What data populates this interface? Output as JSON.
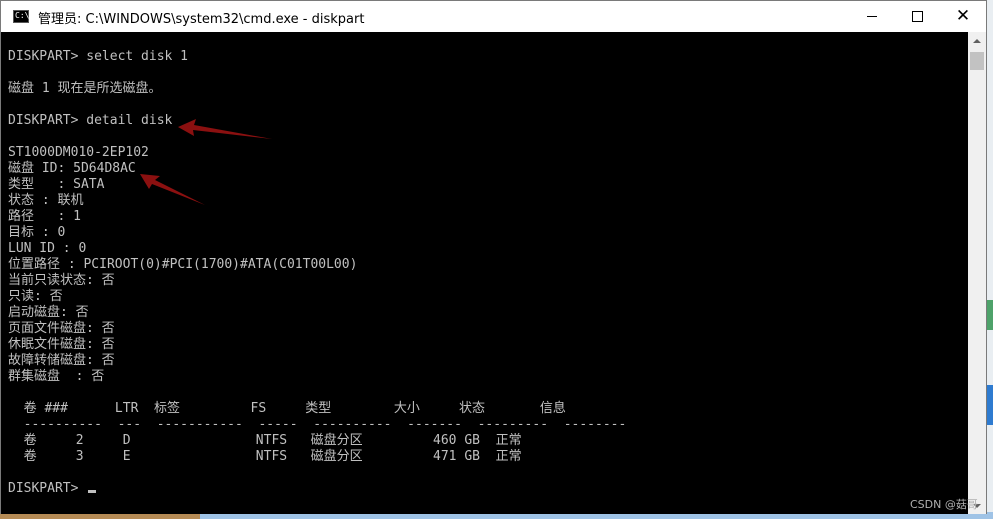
{
  "window": {
    "title": "管理员: C:\\WINDOWS\\system32\\cmd.exe - diskpart",
    "icon_label": "C:\\",
    "icons": {
      "app": "cmd-icon",
      "minimize": "minimize-icon",
      "maximize": "maximize-icon",
      "close": "close-icon"
    }
  },
  "console": {
    "lines": [
      "DISKPART> select disk 1",
      "",
      "磁盘 1 现在是所选磁盘。",
      "",
      "DISKPART> detail disk",
      "",
      "ST1000DM010-2EP102",
      "磁盘 ID: 5D64D8AC",
      "类型   : SATA",
      "状态 : 联机",
      "路径   : 1",
      "目标 : 0",
      "LUN ID : 0",
      "位置路径 : PCIROOT(0)#PCI(1700)#ATA(C01T00L00)",
      "当前只读状态: 否",
      "只读: 否",
      "启动磁盘: 否",
      "页面文件磁盘: 否",
      "休眠文件磁盘: 否",
      "故障转储磁盘: 否",
      "群集磁盘  : 否",
      "",
      "  卷 ###      LTR  标签         FS     类型        大小     状态       信息",
      "  ----------  ---  -----------  -----  ----------  -------  ---------  --------",
      "  卷     2     D                NTFS   磁盘分区         460 GB  正常",
      "  卷     3     E                NTFS   磁盘分区         471 GB  正常",
      "",
      "DISKPART> "
    ]
  },
  "colors": {
    "console_bg": "#000000",
    "console_text": "#c0c0c0",
    "annotation_arrow": "#8b1010"
  },
  "watermark": "CSDN @菇哥"
}
